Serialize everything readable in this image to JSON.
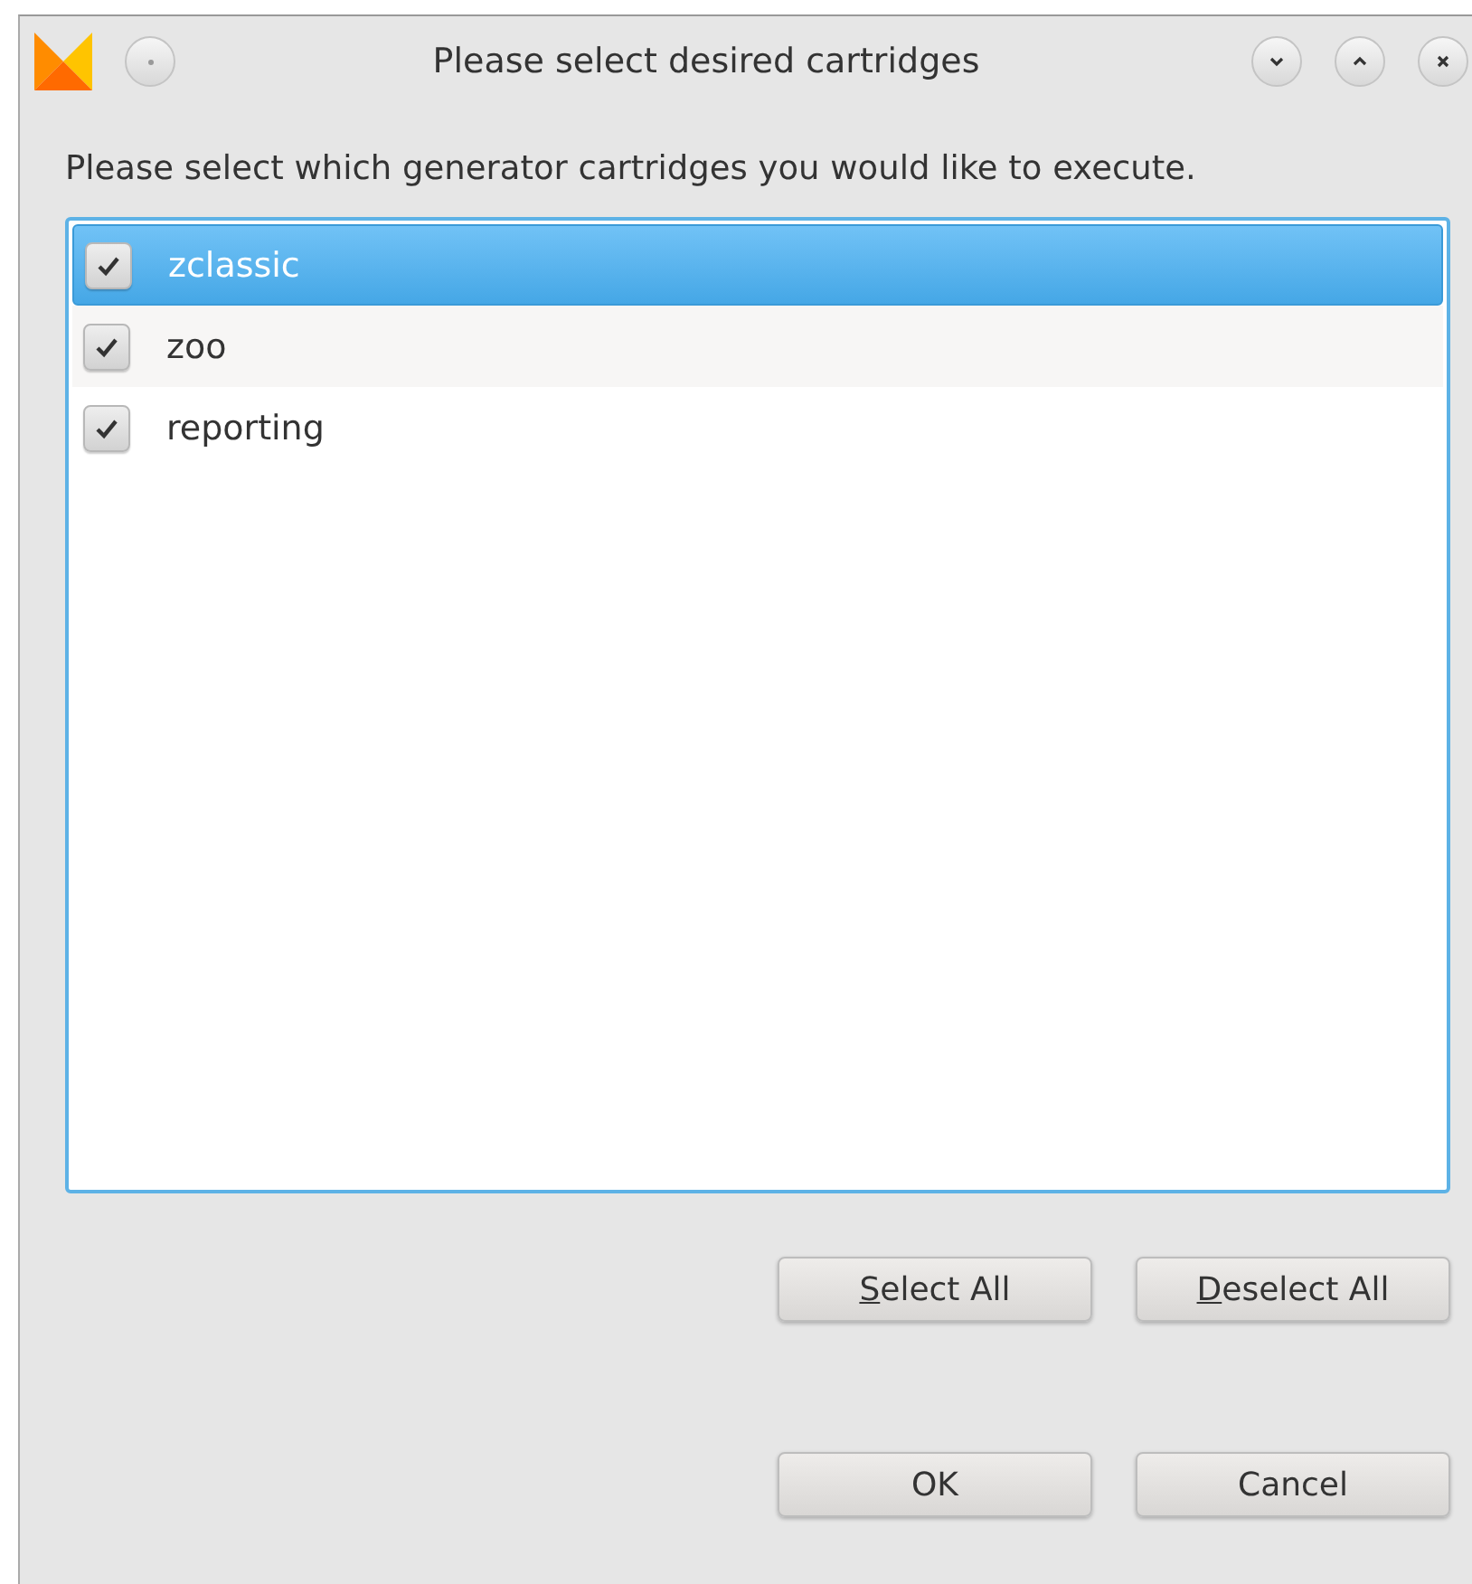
{
  "window": {
    "title": "Please select desired cartridges"
  },
  "instruction": "Please select which generator cartridges you would like to execute.",
  "cartridges": [
    {
      "label": "zclassic",
      "checked": true,
      "selected": true
    },
    {
      "label": "zoo",
      "checked": true,
      "selected": false
    },
    {
      "label": "reporting",
      "checked": true,
      "selected": false
    }
  ],
  "selection_buttons": [
    {
      "mnemonic": "S",
      "rest": "elect All"
    },
    {
      "mnemonic": "D",
      "rest": "eselect All"
    }
  ],
  "dialog_buttons": [
    "OK",
    "Cancel"
  ]
}
